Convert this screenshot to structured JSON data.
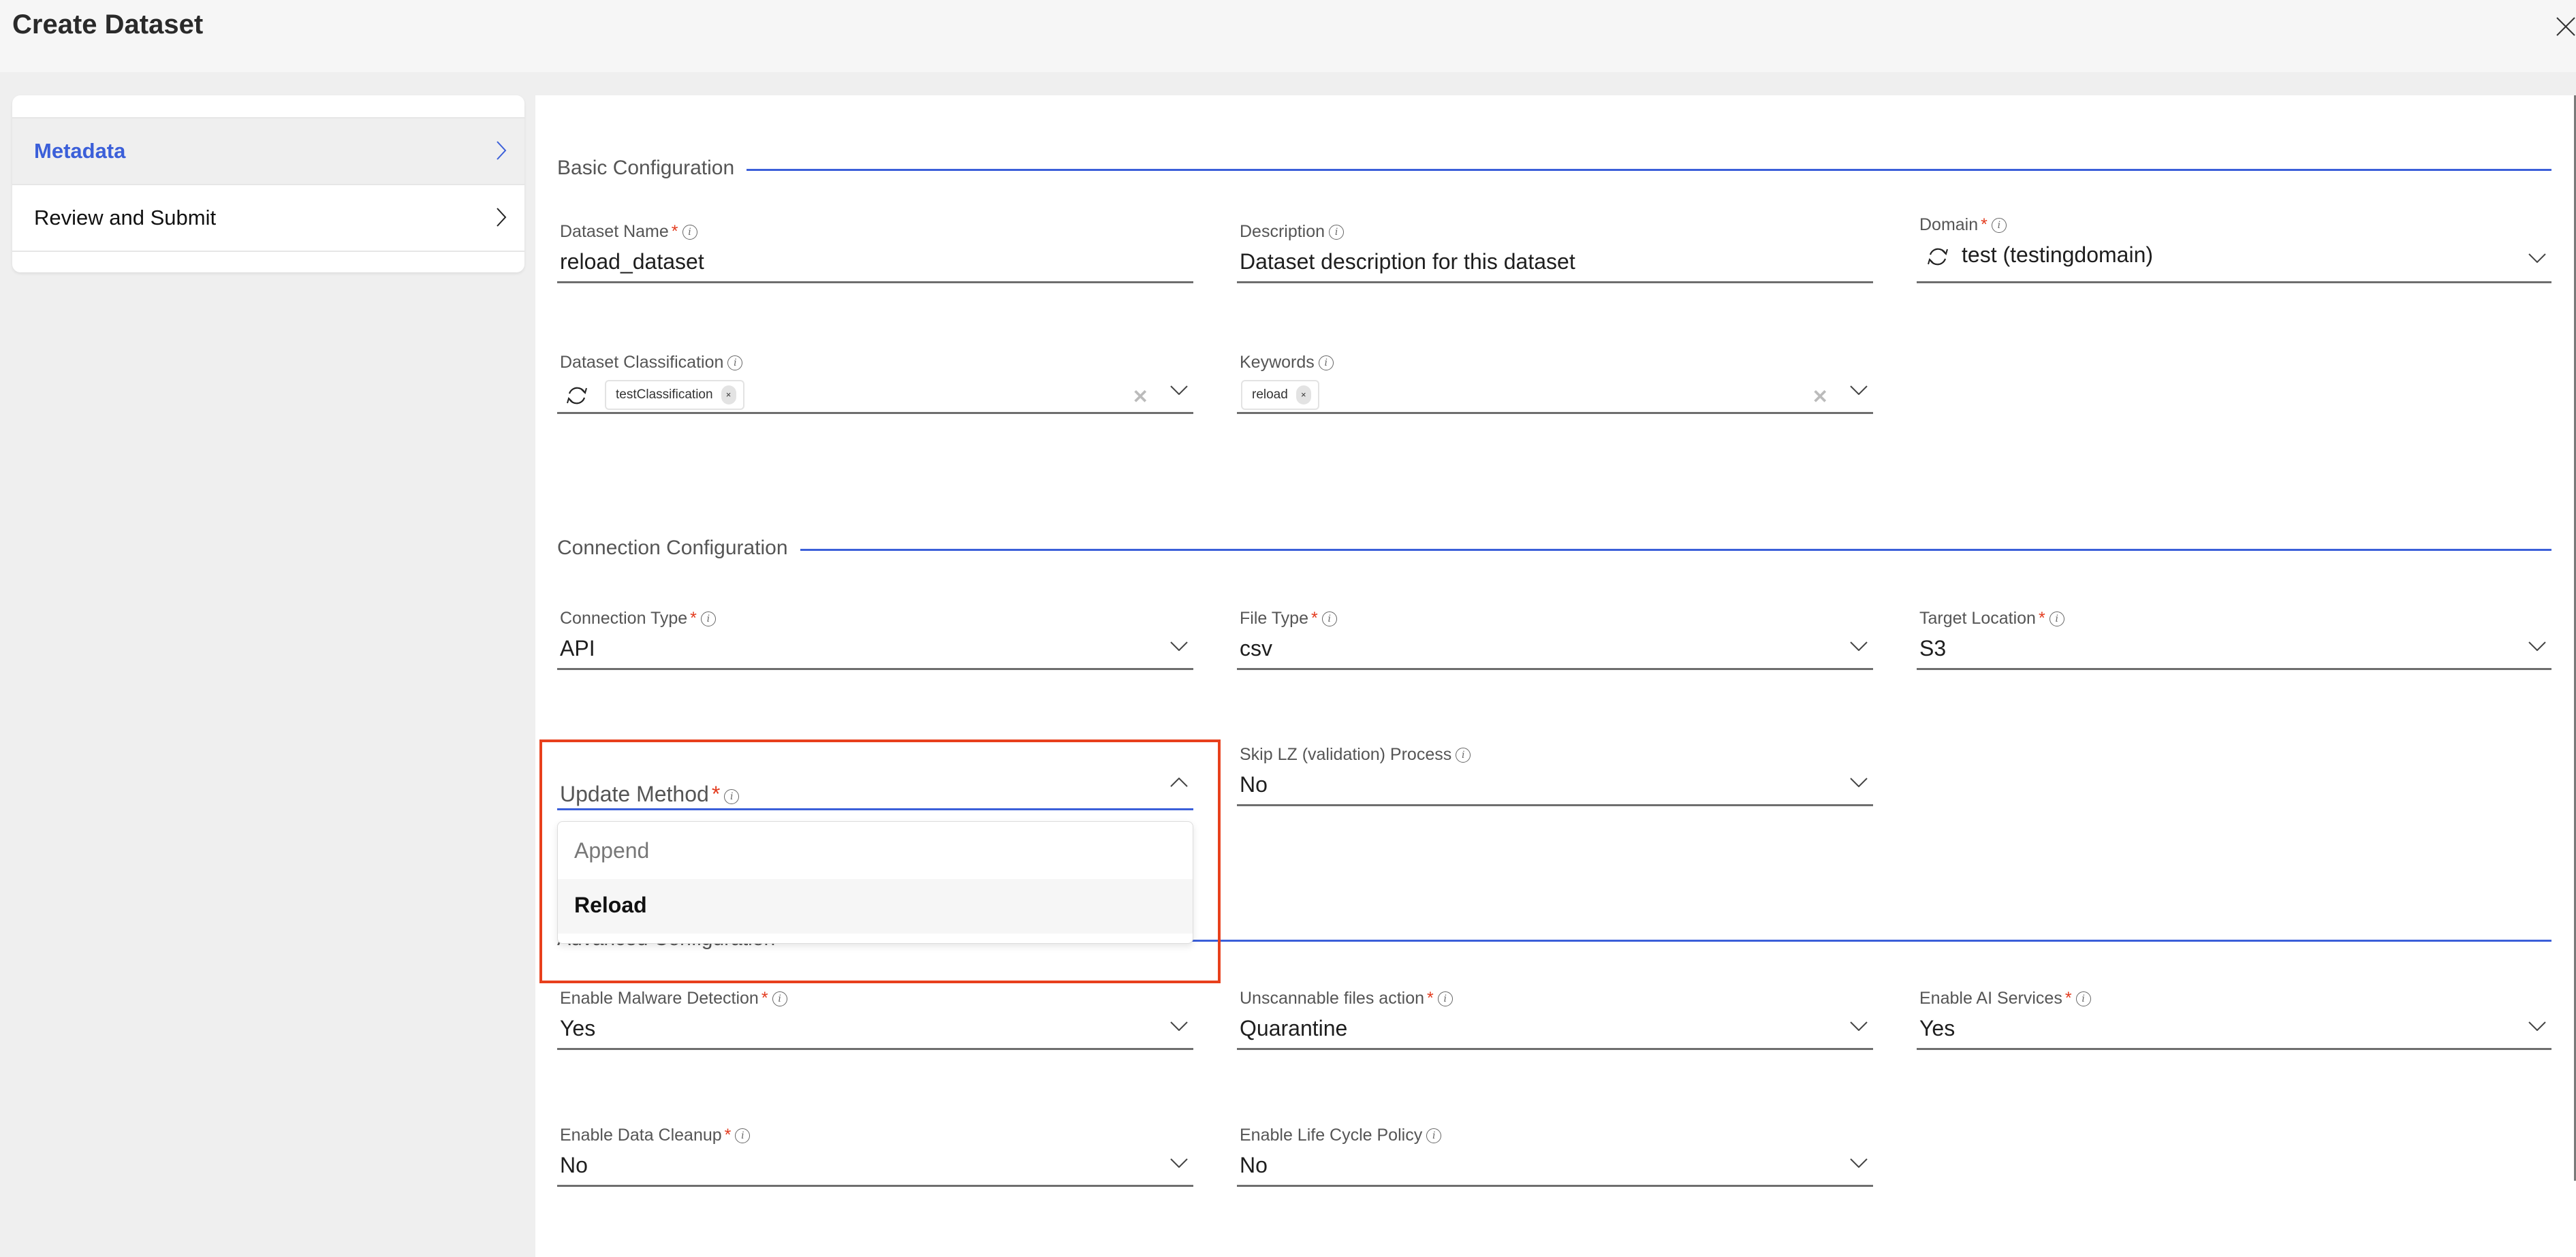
{
  "header": {
    "title": "Create Dataset",
    "close_icon": "close-icon"
  },
  "sidebar": {
    "items": [
      {
        "label": "Metadata",
        "active": true
      },
      {
        "label": "Review and Submit",
        "active": false
      }
    ]
  },
  "colors": {
    "accent": "#3b5fd9",
    "required": "#e33b1e",
    "highlight": "#e8401c"
  },
  "sections": {
    "basic": {
      "title": "Basic Configuration"
    },
    "connection": {
      "title": "Connection Configuration"
    },
    "advanced": {
      "title": "Advanced Configuration"
    }
  },
  "fields": {
    "dataset_name": {
      "label": "Dataset Name",
      "required": "*",
      "value": "reload_dataset"
    },
    "description": {
      "label": "Description",
      "value": "Dataset description for this dataset"
    },
    "domain": {
      "label": "Domain",
      "required": "*",
      "value": "test (testingdomain)"
    },
    "classification": {
      "label": "Dataset Classification",
      "chips": [
        "testClassification"
      ],
      "chip_remove": "×",
      "clear": "✕"
    },
    "keywords": {
      "label": "Keywords",
      "chips": [
        "reload"
      ],
      "chip_remove": "×",
      "clear": "✕"
    },
    "connection_type": {
      "label": "Connection Type",
      "required": "*",
      "value": "API"
    },
    "file_type": {
      "label": "File Type",
      "required": "*",
      "value": "csv"
    },
    "target_location": {
      "label": "Target Location",
      "required": "*",
      "value": "S3"
    },
    "update_method": {
      "label": "Update Method",
      "required": "*",
      "expanded": true,
      "options": [
        "Append",
        "Reload"
      ],
      "hovered_option": "Reload"
    },
    "skip_lz": {
      "label": "Skip LZ (validation) Process",
      "value": "No"
    },
    "malware_detection": {
      "label": "Enable Malware Detection",
      "required": "*",
      "value": "Yes"
    },
    "unscannable_action": {
      "label": "Unscannable files action",
      "required": "*",
      "value": "Quarantine"
    },
    "ai_services": {
      "label": "Enable AI Services",
      "required": "*",
      "value": "Yes"
    },
    "data_cleanup": {
      "label": "Enable Data Cleanup",
      "required": "*",
      "value": "No"
    },
    "life_cycle_policy": {
      "label": "Enable Life Cycle Policy",
      "value": "No"
    }
  }
}
